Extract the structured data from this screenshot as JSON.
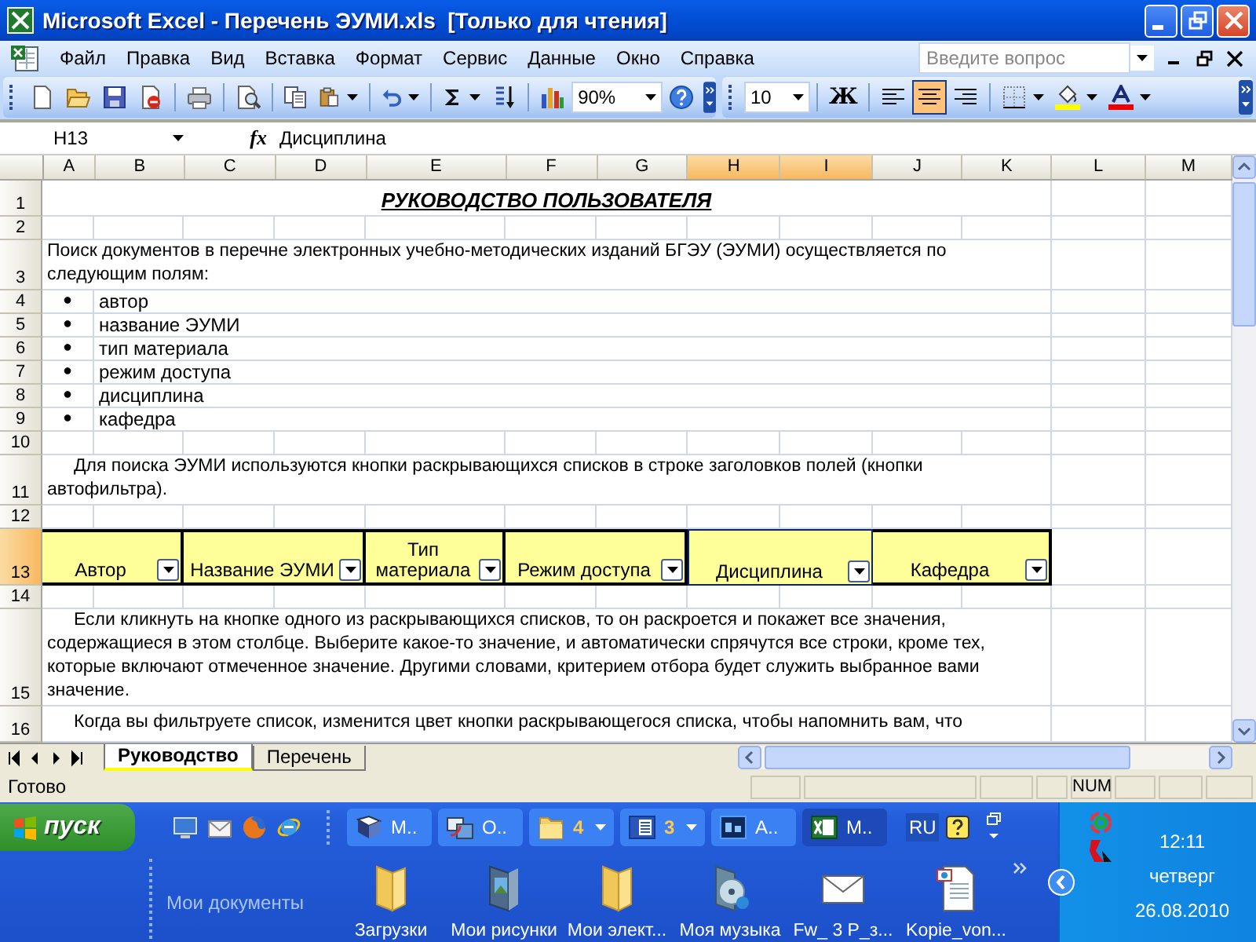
{
  "window": {
    "title": "Microsoft Excel - Перечень ЭУМИ.xls  [Только для чтения]"
  },
  "menu": [
    "Файл",
    "Правка",
    "Вид",
    "Вставка",
    "Формат",
    "Сервис",
    "Данные",
    "Окно",
    "Справка"
  ],
  "help_search": {
    "placeholder": "Введите вопрос"
  },
  "standard_toolbar": [
    {
      "kind": "new"
    },
    {
      "kind": "open"
    },
    {
      "kind": "save"
    },
    {
      "kind": "permission"
    },
    {
      "kind": "separator"
    },
    {
      "kind": "print"
    },
    {
      "kind": "separator"
    },
    {
      "kind": "preview"
    },
    {
      "kind": "separator"
    },
    {
      "kind": "copy"
    },
    {
      "kind": "paste"
    },
    {
      "kind": "separator"
    },
    {
      "kind": "undo"
    },
    {
      "kind": "separator"
    },
    {
      "kind": "sum"
    },
    {
      "kind": "sort"
    },
    {
      "kind": "separator"
    },
    {
      "kind": "chart"
    },
    {
      "kind": "zoom",
      "value": "90%"
    },
    {
      "kind": "help"
    }
  ],
  "formatting_toolbar": [
    {
      "kind": "font-size",
      "value": "10"
    },
    {
      "kind": "separator"
    },
    {
      "kind": "bold",
      "label": "Ж",
      "selected": false
    },
    {
      "kind": "separator"
    },
    {
      "kind": "align-left",
      "selected": false
    },
    {
      "kind": "align-center",
      "selected": true
    },
    {
      "kind": "align-right",
      "selected": false
    },
    {
      "kind": "separator"
    },
    {
      "kind": "borders"
    },
    {
      "kind": "fill-color"
    },
    {
      "kind": "font-color"
    }
  ],
  "formula_bar": {
    "name_box": "H13",
    "function_label": "fx",
    "content": "Дисциплина"
  },
  "sheet": {
    "columns": [
      {
        "label": "A",
        "selected": false
      },
      {
        "label": "B",
        "selected": false
      },
      {
        "label": "C",
        "selected": false
      },
      {
        "label": "D",
        "selected": false
      },
      {
        "label": "E",
        "selected": false
      },
      {
        "label": "F",
        "selected": false
      },
      {
        "label": "G",
        "selected": false
      },
      {
        "label": "H",
        "selected": true
      },
      {
        "label": "I",
        "selected": true
      },
      {
        "label": "J",
        "selected": false
      },
      {
        "label": "K",
        "selected": false
      },
      {
        "label": "L",
        "selected": false
      },
      {
        "label": "M",
        "selected": false
      }
    ],
    "rows": [
      {
        "number": "1",
        "kind": "title",
        "selected": false,
        "heading": "РУКОВОДСТВО ПОЛЬЗОВАТЕЛЯ"
      },
      {
        "number": "2",
        "kind": "blank",
        "selected": false
      },
      {
        "number": "3",
        "kind": "paragraph",
        "selected": false,
        "indented": false,
        "lines": [
          "Поиск документов в перечне электронных учебно-методических изданий БГЭУ (ЭУМИ) осуществляется по",
          "следующим полям:"
        ]
      },
      {
        "number": "4",
        "kind": "bullet",
        "selected": false,
        "bullet": "●",
        "text": "автор"
      },
      {
        "number": "5",
        "kind": "bullet",
        "selected": false,
        "bullet": "●",
        "text": "название ЭУМИ"
      },
      {
        "number": "6",
        "kind": "bullet",
        "selected": false,
        "bullet": "●",
        "text": "тип материала"
      },
      {
        "number": "7",
        "kind": "bullet",
        "selected": false,
        "bullet": "●",
        "text": "режим доступа"
      },
      {
        "number": "8",
        "kind": "bullet",
        "selected": false,
        "bullet": "●",
        "text": "дисциплина"
      },
      {
        "number": "9",
        "kind": "bullet",
        "selected": false,
        "bullet": "●",
        "text": "кафедра"
      },
      {
        "number": "10",
        "kind": "blank",
        "selected": false
      },
      {
        "number": "11",
        "kind": "paragraph",
        "selected": false,
        "indented": true,
        "lines": [
          "Для поиска ЭУМИ используются кнопки раскрывающихся списков в строке заголовков полей (кнопки",
          "автофильтра)."
        ]
      },
      {
        "number": "12",
        "kind": "blank",
        "selected": false
      },
      {
        "number": "13",
        "kind": "filter-header",
        "selected": true,
        "cells": [
          {
            "lines": [
              "Автор"
            ],
            "selected": false
          },
          {
            "lines": [
              "Название ЭУМИ"
            ],
            "selected": false
          },
          {
            "lines": [
              "Тип",
              "материала"
            ],
            "selected": false
          },
          {
            "lines": [
              "Режим доступа"
            ],
            "selected": false
          },
          {
            "lines": [
              "Дисциплина"
            ],
            "selected": true
          },
          {
            "lines": [
              "Кафедра"
            ],
            "selected": false
          }
        ]
      },
      {
        "number": "14",
        "kind": "blank",
        "selected": false
      },
      {
        "number": "15",
        "kind": "paragraph",
        "selected": false,
        "indented": true,
        "lines": [
          "Если кликнуть на кнопке одного из раскрывающихся списков, то он раскроется и покажет все значения,",
          "содержащиеся в этом столбце. Выберите какое-то значение, и автоматически спрячутся все строки, кроме тех,",
          "которые включают отмеченное значение. Другими словами, критерием отбора будет служить выбранное вами",
          "значение."
        ]
      },
      {
        "number": "16",
        "kind": "paragraph",
        "selected": false,
        "indented": true,
        "lines": [
          "Когда вы фильтруете список, изменится цвет кнопки раскрывающегося списка, чтобы напомнить вам, что"
        ]
      }
    ]
  },
  "sheet_tabs": [
    {
      "label": "Руководство",
      "selected": true
    },
    {
      "label": "Перечень",
      "selected": false
    }
  ],
  "status_bar": {
    "text": "Готово",
    "indicators": [
      "NUM"
    ]
  },
  "taskbar": {
    "start": "пуск",
    "tasks": [
      {
        "kind": "book",
        "label": "М..",
        "selected": false
      },
      {
        "kind": "network",
        "label": "О..",
        "selected": false
      },
      {
        "kind": "folder",
        "label": "4",
        "selected": false
      },
      {
        "kind": "word",
        "label": "3",
        "selected": false
      },
      {
        "kind": "photoshop",
        "label": "А..",
        "selected": false
      },
      {
        "kind": "excel",
        "label": "М..",
        "selected": true
      }
    ],
    "language": "RU",
    "toolbar_title": "Мои документы",
    "documents": [
      {
        "kind": "folder",
        "label": "Загрузки"
      },
      {
        "kind": "pictures",
        "label": "Мои рисунки"
      },
      {
        "kind": "folder",
        "label": "Мои элект..."
      },
      {
        "kind": "music",
        "label": "Моя музыка"
      },
      {
        "kind": "mail",
        "label": "Fw_ 3 P_з..."
      },
      {
        "kind": "document",
        "label": "Kopie_von..."
      }
    ],
    "clock": {
      "time": "12:11",
      "day": "четверг",
      "date": "26.08.2010"
    }
  }
}
